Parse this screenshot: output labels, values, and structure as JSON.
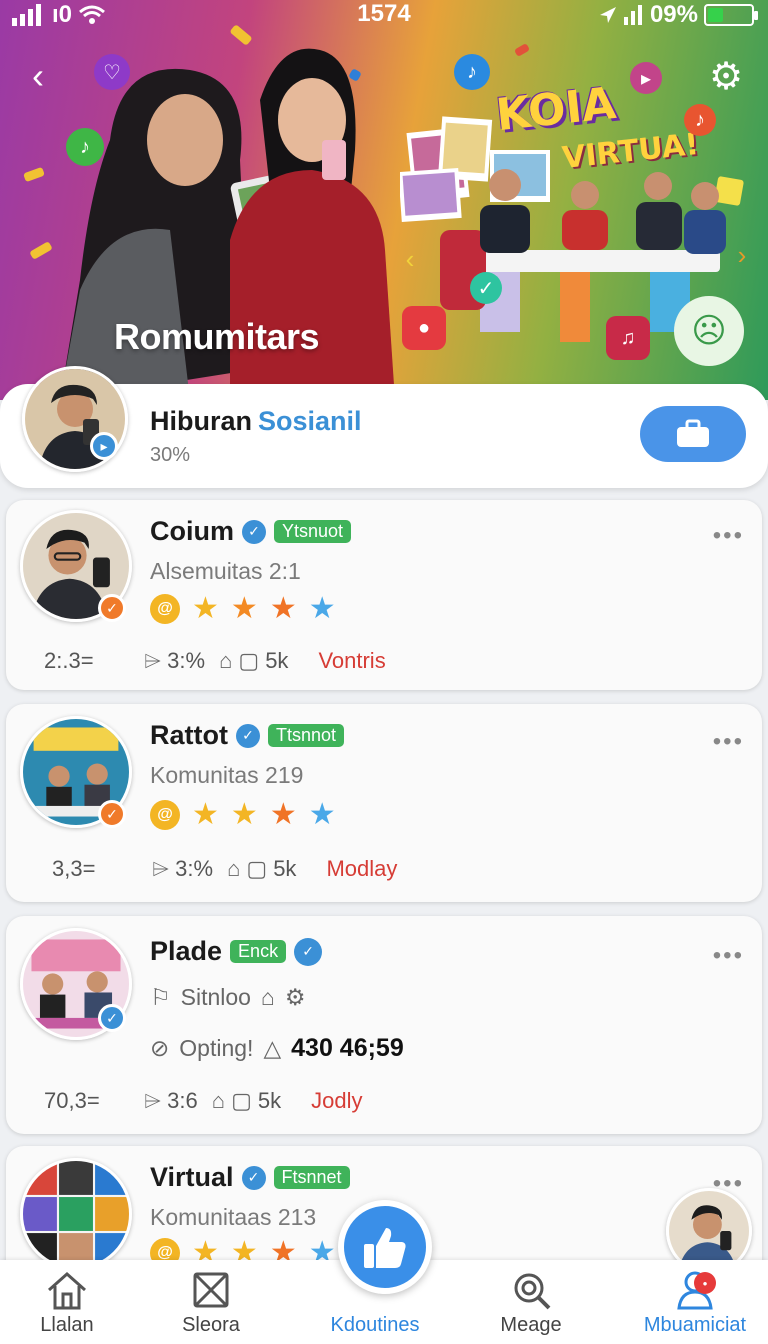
{
  "status_bar": {
    "time": "1574",
    "battery": "09%",
    "battery_level": 0.35
  },
  "hero": {
    "title": "Romumitars",
    "promo_line1": "KOIA",
    "promo_line2": "VIRTUA!"
  },
  "profile": {
    "name": "Hiburan",
    "accent": "Sosianil",
    "subtitle": "30%"
  },
  "cards": [
    {
      "name": "Coium",
      "tag": "Ytsnuot",
      "subtitle": "Alsemuitas 2:1",
      "stars": [
        "#f3b524",
        "#f38a24",
        "#f07326",
        "#4aa8e8"
      ],
      "stat_num": "2:.3=",
      "stat1": "3:%",
      "stat2": "5k",
      "link": "Vontris"
    },
    {
      "name": "Rattot",
      "tag": "Ttsnnot",
      "subtitle": "Komunitas 219",
      "stars": [
        "#f3b524",
        "#f3b524",
        "#f07326",
        "#4aa8e8"
      ],
      "stat_num": "3,3=",
      "stat1": "3:%",
      "stat2": "5k",
      "link": "Modlay"
    },
    {
      "name": "Plade",
      "tag": "Enck",
      "subtitle": "Sitnloo",
      "extra_label": "Opting!",
      "extra_value": "430 46;59",
      "stat_num": "70,3=",
      "stat1": "3:6",
      "stat2": "5k",
      "link": "Jodly"
    },
    {
      "name": "Virtual",
      "tag": "Ftsnnet",
      "subtitle": "Komunitaas 213",
      "stars": [
        "#f3b524",
        "#f3b524",
        "#f07326",
        "#4aa8e8"
      ]
    }
  ],
  "nav": [
    {
      "label": "Llalan",
      "icon": "home-icon"
    },
    {
      "label": "Sleora",
      "icon": "box-icon"
    },
    {
      "label": "Kdoutines",
      "icon": "thumbs-up-icon"
    },
    {
      "label": "Meage",
      "icon": "search-icon"
    },
    {
      "label": "Mbuamiciat",
      "icon": "user-icon"
    }
  ],
  "colors": {
    "accent": "#3a8fe8",
    "link": "#d63c35",
    "tag": "#3fb35a"
  }
}
